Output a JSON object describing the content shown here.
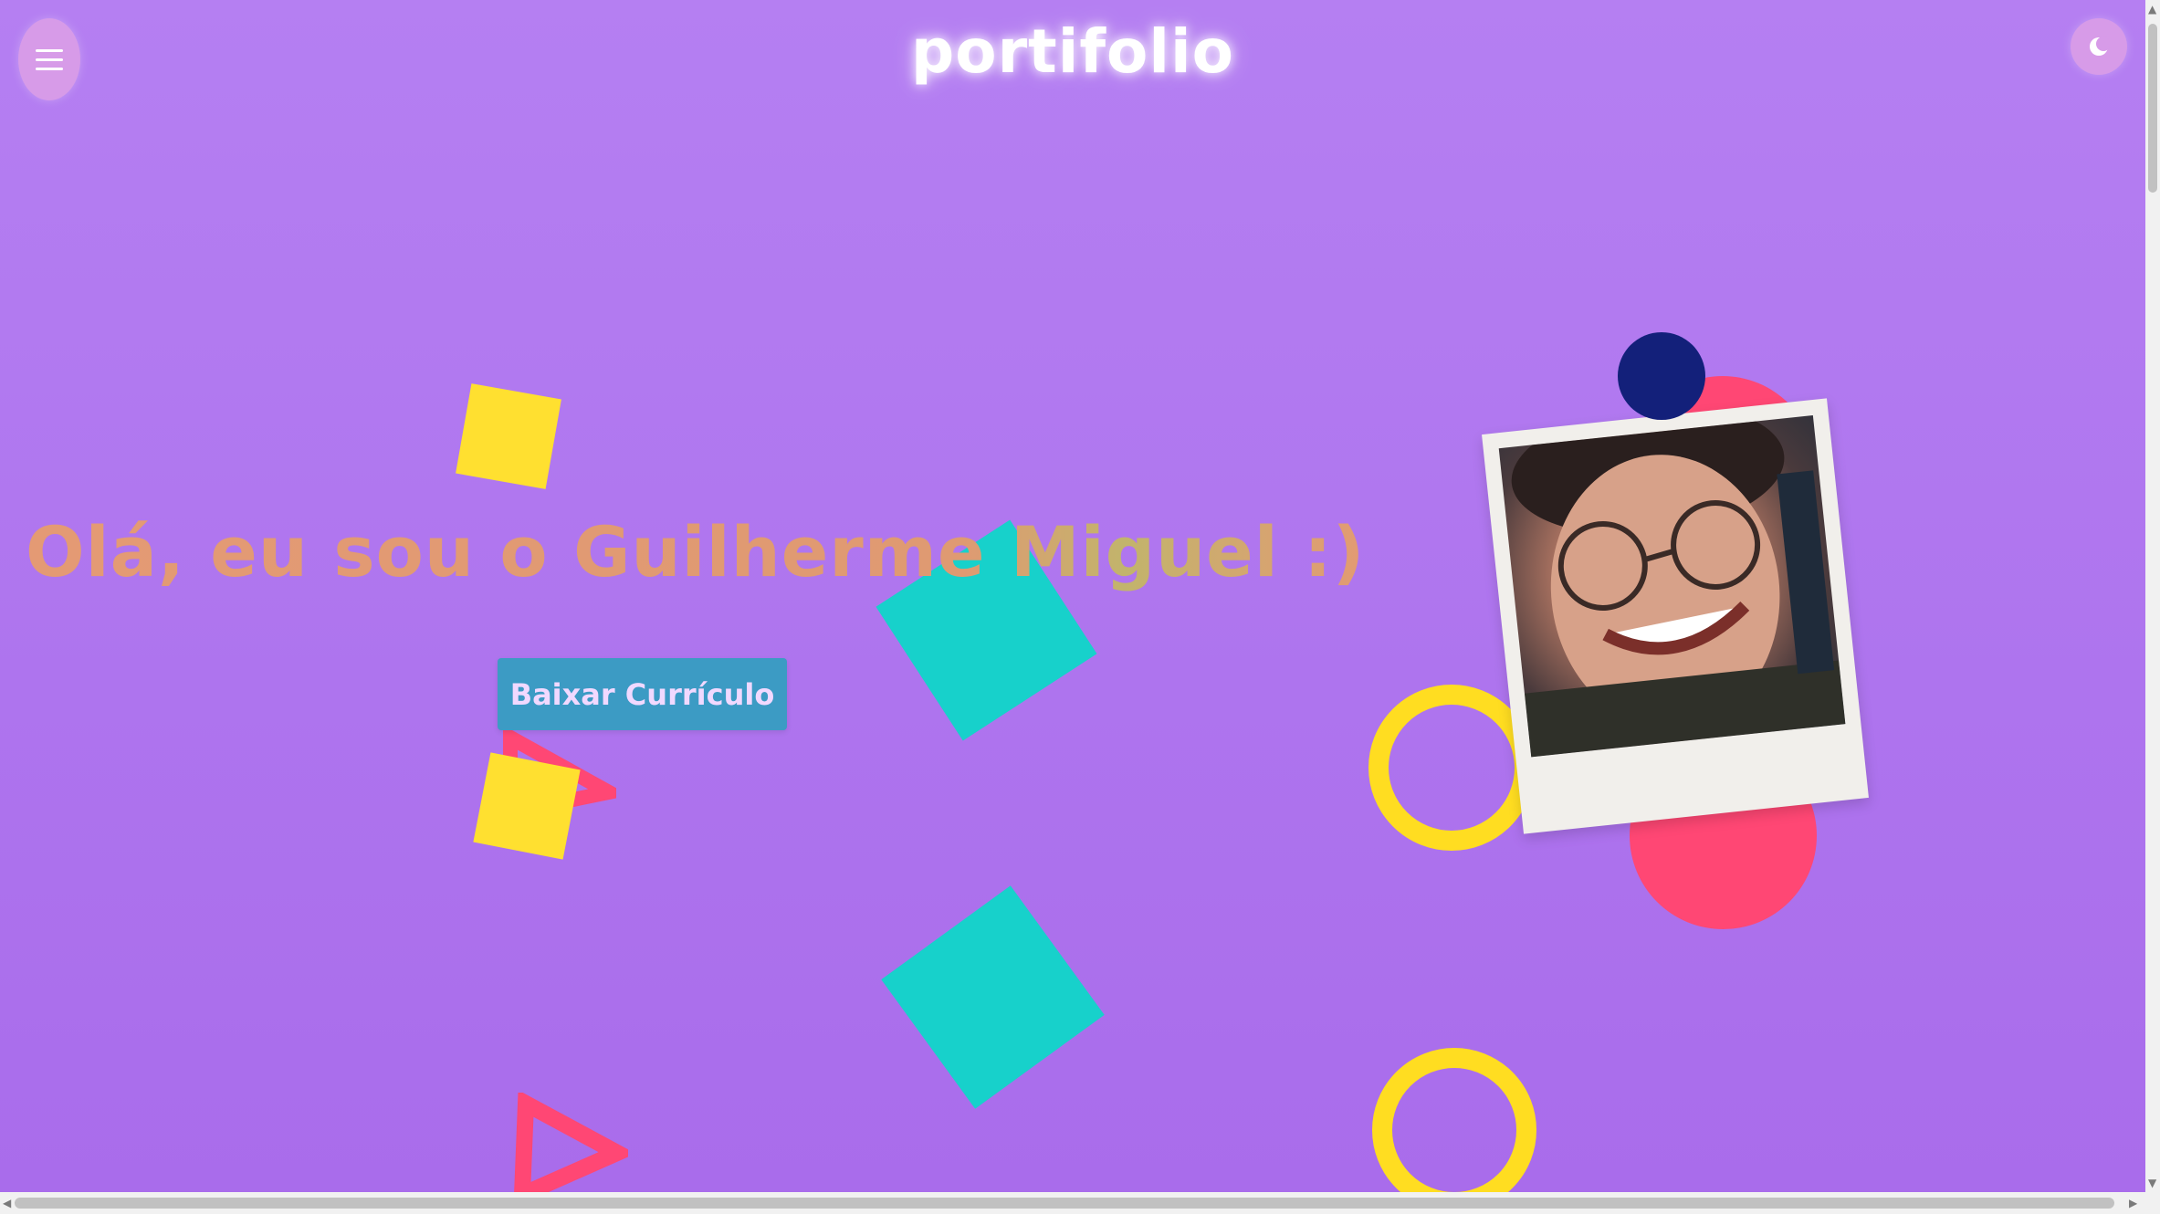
{
  "header": {
    "logo_text": "portifolio",
    "menu_icon": "hamburger-icon",
    "theme_icon": "moon-icon"
  },
  "hero": {
    "title": "Olá, eu sou o Guilherme Miguel :)",
    "cv_button": "Baixar Currículo",
    "photo_icon": "profile-photo"
  },
  "colors": {
    "background": "#b17af0",
    "yellow": "#ffe030",
    "cyan": "#17d1cb",
    "pink": "#ff4774",
    "navy": "#13207a",
    "button": "#3c9bc4",
    "title": "#e49a74"
  }
}
